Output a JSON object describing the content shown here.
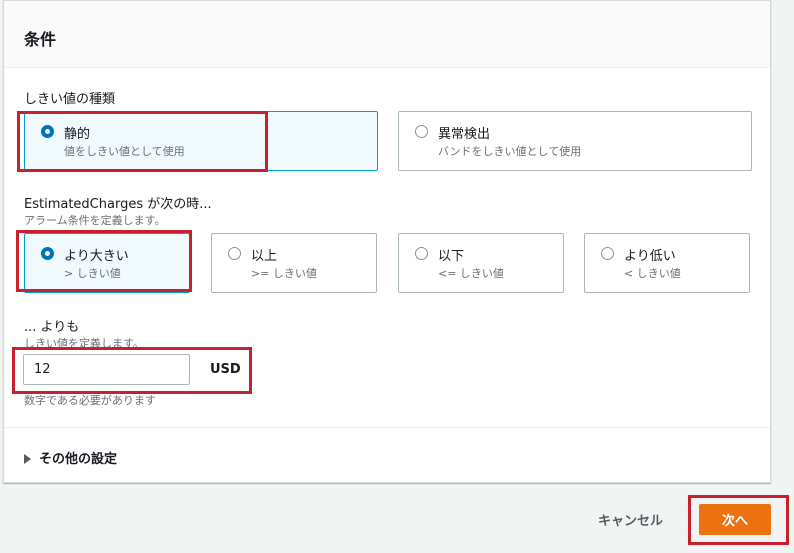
{
  "panel": {
    "title": "条件"
  },
  "threshold_type": {
    "label": "しきい値の種類",
    "options": [
      {
        "label": "静的",
        "desc": "値をしきい値として使用",
        "selected": true
      },
      {
        "label": "異常検出",
        "desc": "バンドをしきい値として使用",
        "selected": false
      }
    ]
  },
  "comparison": {
    "label": "EstimatedCharges が次の時...",
    "desc": "アラーム条件を定義します。",
    "options": [
      {
        "label": "より大きい",
        "desc": "> しきい値",
        "selected": true
      },
      {
        "label": "以上",
        "desc": ">= しきい値",
        "selected": false
      },
      {
        "label": "以下",
        "desc": "<= しきい値",
        "selected": false
      },
      {
        "label": "より低い",
        "desc": "< しきい値",
        "selected": false
      }
    ]
  },
  "threshold_value": {
    "label": "... よりも",
    "desc": "しきい値を定義します。",
    "value": "12",
    "unit": "USD",
    "hint": "数字である必要があります"
  },
  "additional": {
    "label": "その他の設定"
  },
  "footer": {
    "cancel": "キャンセル",
    "next": "次へ"
  },
  "colors": {
    "accent": "#0073bb",
    "primary_button": "#ec7211",
    "highlight": "#c7202f"
  }
}
